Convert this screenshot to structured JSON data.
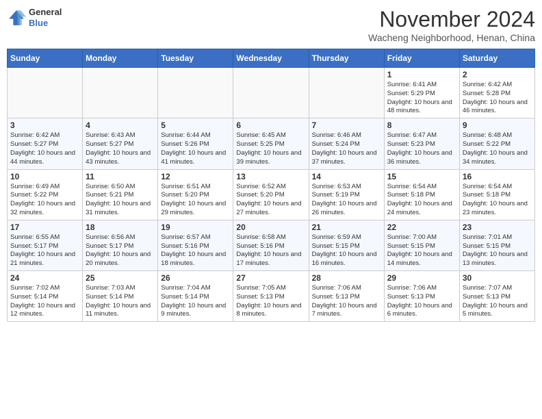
{
  "header": {
    "logo_line1": "General",
    "logo_line2": "Blue",
    "month": "November 2024",
    "location": "Wacheng Neighborhood, Henan, China"
  },
  "weekdays": [
    "Sunday",
    "Monday",
    "Tuesday",
    "Wednesday",
    "Thursday",
    "Friday",
    "Saturday"
  ],
  "weeks": [
    [
      {
        "day": "",
        "info": ""
      },
      {
        "day": "",
        "info": ""
      },
      {
        "day": "",
        "info": ""
      },
      {
        "day": "",
        "info": ""
      },
      {
        "day": "",
        "info": ""
      },
      {
        "day": "1",
        "info": "Sunrise: 6:41 AM\nSunset: 5:29 PM\nDaylight: 10 hours and 48 minutes."
      },
      {
        "day": "2",
        "info": "Sunrise: 6:42 AM\nSunset: 5:28 PM\nDaylight: 10 hours and 46 minutes."
      }
    ],
    [
      {
        "day": "3",
        "info": "Sunrise: 6:42 AM\nSunset: 5:27 PM\nDaylight: 10 hours and 44 minutes."
      },
      {
        "day": "4",
        "info": "Sunrise: 6:43 AM\nSunset: 5:27 PM\nDaylight: 10 hours and 43 minutes."
      },
      {
        "day": "5",
        "info": "Sunrise: 6:44 AM\nSunset: 5:26 PM\nDaylight: 10 hours and 41 minutes."
      },
      {
        "day": "6",
        "info": "Sunrise: 6:45 AM\nSunset: 5:25 PM\nDaylight: 10 hours and 39 minutes."
      },
      {
        "day": "7",
        "info": "Sunrise: 6:46 AM\nSunset: 5:24 PM\nDaylight: 10 hours and 37 minutes."
      },
      {
        "day": "8",
        "info": "Sunrise: 6:47 AM\nSunset: 5:23 PM\nDaylight: 10 hours and 36 minutes."
      },
      {
        "day": "9",
        "info": "Sunrise: 6:48 AM\nSunset: 5:22 PM\nDaylight: 10 hours and 34 minutes."
      }
    ],
    [
      {
        "day": "10",
        "info": "Sunrise: 6:49 AM\nSunset: 5:22 PM\nDaylight: 10 hours and 32 minutes."
      },
      {
        "day": "11",
        "info": "Sunrise: 6:50 AM\nSunset: 5:21 PM\nDaylight: 10 hours and 31 minutes."
      },
      {
        "day": "12",
        "info": "Sunrise: 6:51 AM\nSunset: 5:20 PM\nDaylight: 10 hours and 29 minutes."
      },
      {
        "day": "13",
        "info": "Sunrise: 6:52 AM\nSunset: 5:20 PM\nDaylight: 10 hours and 27 minutes."
      },
      {
        "day": "14",
        "info": "Sunrise: 6:53 AM\nSunset: 5:19 PM\nDaylight: 10 hours and 26 minutes."
      },
      {
        "day": "15",
        "info": "Sunrise: 6:54 AM\nSunset: 5:18 PM\nDaylight: 10 hours and 24 minutes."
      },
      {
        "day": "16",
        "info": "Sunrise: 6:54 AM\nSunset: 5:18 PM\nDaylight: 10 hours and 23 minutes."
      }
    ],
    [
      {
        "day": "17",
        "info": "Sunrise: 6:55 AM\nSunset: 5:17 PM\nDaylight: 10 hours and 21 minutes."
      },
      {
        "day": "18",
        "info": "Sunrise: 6:56 AM\nSunset: 5:17 PM\nDaylight: 10 hours and 20 minutes."
      },
      {
        "day": "19",
        "info": "Sunrise: 6:57 AM\nSunset: 5:16 PM\nDaylight: 10 hours and 18 minutes."
      },
      {
        "day": "20",
        "info": "Sunrise: 6:58 AM\nSunset: 5:16 PM\nDaylight: 10 hours and 17 minutes."
      },
      {
        "day": "21",
        "info": "Sunrise: 6:59 AM\nSunset: 5:15 PM\nDaylight: 10 hours and 16 minutes."
      },
      {
        "day": "22",
        "info": "Sunrise: 7:00 AM\nSunset: 5:15 PM\nDaylight: 10 hours and 14 minutes."
      },
      {
        "day": "23",
        "info": "Sunrise: 7:01 AM\nSunset: 5:15 PM\nDaylight: 10 hours and 13 minutes."
      }
    ],
    [
      {
        "day": "24",
        "info": "Sunrise: 7:02 AM\nSunset: 5:14 PM\nDaylight: 10 hours and 12 minutes."
      },
      {
        "day": "25",
        "info": "Sunrise: 7:03 AM\nSunset: 5:14 PM\nDaylight: 10 hours and 11 minutes."
      },
      {
        "day": "26",
        "info": "Sunrise: 7:04 AM\nSunset: 5:14 PM\nDaylight: 10 hours and 9 minutes."
      },
      {
        "day": "27",
        "info": "Sunrise: 7:05 AM\nSunset: 5:13 PM\nDaylight: 10 hours and 8 minutes."
      },
      {
        "day": "28",
        "info": "Sunrise: 7:06 AM\nSunset: 5:13 PM\nDaylight: 10 hours and 7 minutes."
      },
      {
        "day": "29",
        "info": "Sunrise: 7:06 AM\nSunset: 5:13 PM\nDaylight: 10 hours and 6 minutes."
      },
      {
        "day": "30",
        "info": "Sunrise: 7:07 AM\nSunset: 5:13 PM\nDaylight: 10 hours and 5 minutes."
      }
    ]
  ]
}
